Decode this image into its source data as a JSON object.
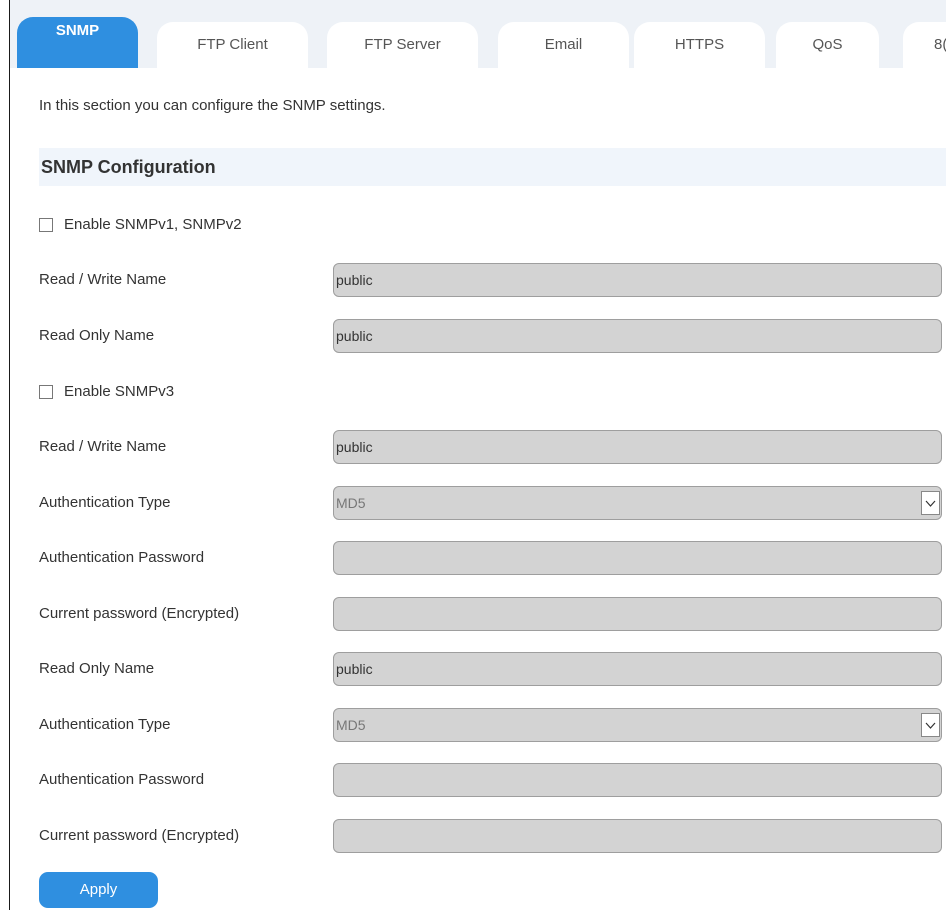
{
  "tabs": [
    {
      "label": "SNMP",
      "active": true
    },
    {
      "label": "FTP Client"
    },
    {
      "label": "FTP Server"
    },
    {
      "label": "Email"
    },
    {
      "label": "HTTPS"
    },
    {
      "label": "QoS"
    },
    {
      "label": "8("
    }
  ],
  "intro": "In this section you can configure the SNMP settings.",
  "section_title": "SNMP Configuration",
  "v1v2": {
    "enable_label": "Enable SNMPv1, SNMPv2",
    "enabled": false,
    "rw_label": "Read / Write Name",
    "rw_value": "public",
    "ro_label": "Read Only Name",
    "ro_value": "public"
  },
  "v3": {
    "enable_label": "Enable SNMPv3",
    "enabled": false,
    "rw": {
      "name_label": "Read / Write Name",
      "name_value": "public",
      "auth_type_label": "Authentication Type",
      "auth_type_value": "MD5",
      "auth_pw_label": "Authentication Password",
      "auth_pw_value": "",
      "current_pw_label": "Current password (Encrypted)",
      "current_pw_value": ""
    },
    "ro": {
      "name_label": "Read Only Name",
      "name_value": "public",
      "auth_type_label": "Authentication Type",
      "auth_type_value": "MD5",
      "auth_pw_label": "Authentication Password",
      "auth_pw_value": "",
      "current_pw_label": "Current password (Encrypted)",
      "current_pw_value": ""
    }
  },
  "apply_label": "Apply",
  "colors": {
    "accent": "#2f8fe0",
    "field_bg": "#d3d3d3",
    "section_bg": "#f0f5fb"
  }
}
